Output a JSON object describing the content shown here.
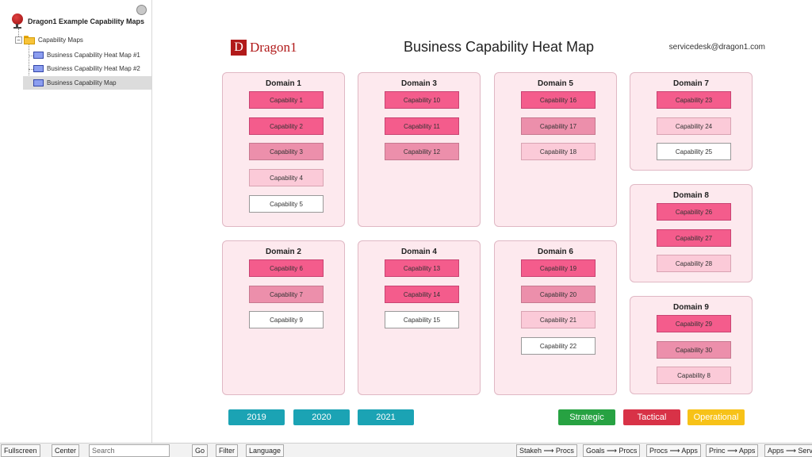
{
  "sidebar": {
    "root_label": "Dragon1 Example Capability Maps",
    "folder_label": "Capability Maps",
    "items": [
      {
        "label": "Business Capability Heat Map #1"
      },
      {
        "label": "Business Capability Heat Map #2"
      },
      {
        "label": "Business Capability Map"
      }
    ]
  },
  "header": {
    "logo_letter": "D",
    "logo_text": "Dragon1",
    "title": "Business Capability Heat Map",
    "email": "servicedesk@dragon1.com"
  },
  "colors": {
    "high": "#f45c8c",
    "mid": "#ec8fab",
    "low": "#fbcad8",
    "none": "#ffffff",
    "year_button": "#1ba3b4",
    "strategic": "#27a242",
    "tactical": "#d83247",
    "operational": "#f7c218"
  },
  "domains": [
    {
      "title": "Domain 1",
      "capabilities": [
        {
          "label": "Capability 1",
          "level": "high"
        },
        {
          "label": "Capability 2",
          "level": "high"
        },
        {
          "label": "Capability 3",
          "level": "mid"
        },
        {
          "label": "Capability 4",
          "level": "low"
        },
        {
          "label": "Capability 5",
          "level": "none"
        }
      ]
    },
    {
      "title": "Domain 3",
      "capabilities": [
        {
          "label": "Capability 10",
          "level": "high"
        },
        {
          "label": "Capability 11",
          "level": "high"
        },
        {
          "label": "Capability 12",
          "level": "mid"
        }
      ]
    },
    {
      "title": "Domain 5",
      "capabilities": [
        {
          "label": "Capability 16",
          "level": "high"
        },
        {
          "label": "Capability 17",
          "level": "mid"
        },
        {
          "label": "Capability 18",
          "level": "low"
        }
      ]
    },
    {
      "title": "Domain 7",
      "capabilities": [
        {
          "label": "Capability 23",
          "level": "high"
        },
        {
          "label": "Capability 24",
          "level": "low"
        },
        {
          "label": "Capability 25",
          "level": "none"
        }
      ]
    },
    {
      "title": "Domain 2",
      "capabilities": [
        {
          "label": "Capability 6",
          "level": "high"
        },
        {
          "label": "Capability 7",
          "level": "mid"
        },
        {
          "label": "Capability 9",
          "level": "none"
        }
      ]
    },
    {
      "title": "Domain 4",
      "capabilities": [
        {
          "label": "Capability 13",
          "level": "high"
        },
        {
          "label": "Capability 14",
          "level": "high"
        },
        {
          "label": "Capability 15",
          "level": "none"
        }
      ]
    },
    {
      "title": "Domain 6",
      "capabilities": [
        {
          "label": "Capability 19",
          "level": "high"
        },
        {
          "label": "Capability 20",
          "level": "mid"
        },
        {
          "label": "Capability 21",
          "level": "low"
        },
        {
          "label": "Capability 22",
          "level": "none"
        }
      ]
    },
    {
      "title": "Domain 8",
      "capabilities": [
        {
          "label": "Capability 26",
          "level": "high"
        },
        {
          "label": "Capability 27",
          "level": "high"
        },
        {
          "label": "Capability 28",
          "level": "low"
        }
      ]
    },
    {
      "title": "Domain 9",
      "capabilities": [
        {
          "label": "Capability 29",
          "level": "high"
        },
        {
          "label": "Capability 30",
          "level": "mid"
        },
        {
          "label": "Capability 8",
          "level": "low"
        }
      ]
    }
  ],
  "years": [
    "2019",
    "2020",
    "2021"
  ],
  "legend": [
    "Strategic",
    "Tactical",
    "Operational"
  ],
  "bottombar": {
    "fullscreen": "Fullscreen",
    "center": "Center",
    "search_placeholder": "Search",
    "go": "Go",
    "filter": "Filter",
    "language": "Language",
    "views": [
      "Stakeh ⟶ Procs",
      "Goals ⟶ Procs",
      "Procs ⟶ Apps",
      "Princ ⟶ Apps",
      "Apps ⟶ Serv."
    ]
  }
}
